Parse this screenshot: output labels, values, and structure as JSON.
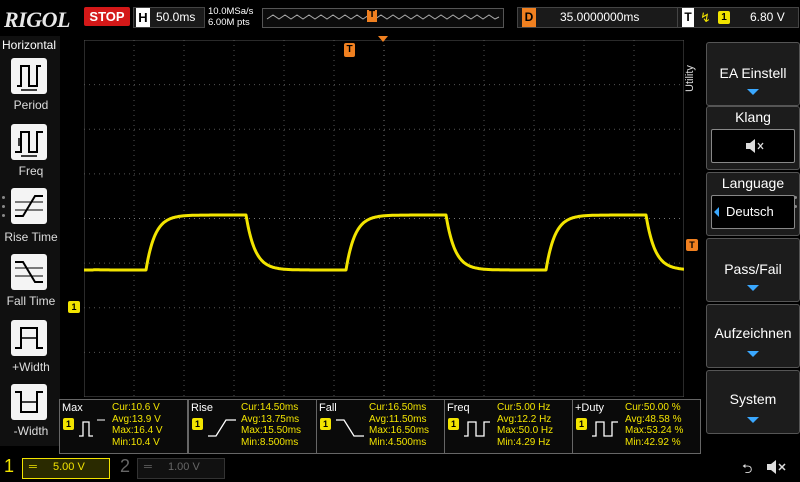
{
  "top_bar": {
    "logo": "RIGOL",
    "run_state": "STOP",
    "horizontal_label": "H",
    "timebase": "50.0ms",
    "sample_rate": "10.0MSa/s",
    "memory_depth": "6.00M pts",
    "trigger_marker": "T",
    "delay_label": "D",
    "delay_value": "35.0000000ms",
    "trigger_label": "T",
    "trigger_source": "1",
    "trigger_level": "6.80 V"
  },
  "left_panel": {
    "title": "Horizontal",
    "items": [
      {
        "label": "Period",
        "icon": "period-icon"
      },
      {
        "label": "Freq",
        "icon": "freq-icon"
      },
      {
        "label": "Rise Time",
        "icon": "rise-time-icon"
      },
      {
        "label": "Fall Time",
        "icon": "fall-time-icon"
      },
      {
        "label": "+Width",
        "icon": "pos-width-icon"
      },
      {
        "label": "-Width",
        "icon": "neg-width-icon"
      }
    ]
  },
  "right_menu": {
    "tab": "Utility",
    "items": [
      {
        "label": "EA Einstell"
      },
      {
        "label": "Klang",
        "icon": "speaker-mute-icon"
      },
      {
        "label": "Language",
        "value": "Deutsch"
      },
      {
        "label": "Pass/Fail"
      },
      {
        "label": "Aufzeichnen"
      },
      {
        "label": "System"
      }
    ]
  },
  "markers": {
    "trigger_top": "T",
    "ch1_ground": "1",
    "trigger_level": "T"
  },
  "measurements": [
    {
      "name": "Max",
      "channel": "1",
      "cur": "Cur:10.6 V",
      "avg": "Avg:13.9 V",
      "max": "Max:16.4 V",
      "min": "Min:10.4 V"
    },
    {
      "name": "Rise",
      "channel": "1",
      "cur": "Cur:14.50ms",
      "avg": "Avg:13.75ms",
      "max": "Max:15.50ms",
      "min": "Min:8.500ms"
    },
    {
      "name": "Fall",
      "channel": "1",
      "cur": "Cur:16.50ms",
      "avg": "Avg:11.50ms",
      "max": "Max:16.50ms",
      "min": "Min:4.500ms"
    },
    {
      "name": "Freq",
      "channel": "1",
      "cur": "Cur:5.00 Hz",
      "avg": "Avg:12.2 Hz",
      "max": "Max:50.0 Hz",
      "min": "Min:4.29 Hz"
    },
    {
      "name": "+Duty",
      "channel": "1",
      "cur": "Cur:50.00 %",
      "avg": "Avg:48.58 %",
      "max": "Max:53.24 %",
      "min": "Min:42.92 %"
    }
  ],
  "channels": [
    {
      "number": "1",
      "coupling": "═",
      "scale": "5.00 V"
    },
    {
      "number": "2",
      "coupling": "═",
      "scale": "1.00 V"
    }
  ],
  "colors": {
    "ch1": "#f2e400",
    "trigger": "#f08020",
    "stop": "#d41818",
    "accent": "#3aa8ff"
  }
}
